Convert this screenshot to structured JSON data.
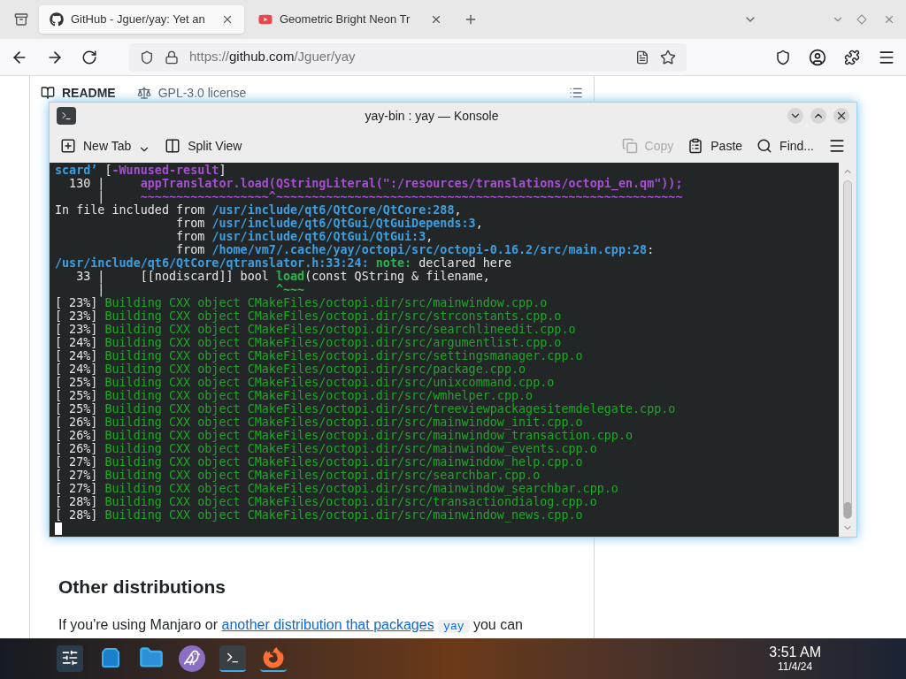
{
  "browser": {
    "tabs": [
      {
        "title": "GitHub - Jguer/yay: Yet an",
        "selected": true,
        "kind": "github"
      },
      {
        "title": "Geometric Bright Neon Tr",
        "selected": false,
        "kind": "youtube"
      }
    ],
    "url": {
      "scheme": "https://",
      "host": "github.com",
      "path": "/Jguer/yay"
    }
  },
  "page": {
    "readme_tabs": [
      {
        "label": "README",
        "selected": true,
        "kind": "book"
      },
      {
        "label": "GPL-3.0 license",
        "selected": false,
        "kind": "scale"
      }
    ],
    "heading": "Other distributions",
    "paragraph": {
      "before": "If you're using Manjaro or ",
      "link": "another distribution that packages",
      "code": "yay",
      "after": " you can"
    }
  },
  "konsole": {
    "title": "yay-bin : yay — Konsole",
    "toolbar_left": [
      {
        "label": "New Tab",
        "kind": "newtab",
        "dropdown": true,
        "disabled": false
      },
      {
        "label": "Split View",
        "kind": "split",
        "dropdown": false,
        "disabled": false
      }
    ],
    "toolbar_right": [
      {
        "label": "Copy",
        "kind": "copy",
        "disabled": true
      },
      {
        "label": "Paste",
        "kind": "paste",
        "disabled": false
      },
      {
        "label": "Find...",
        "kind": "find",
        "disabled": false
      }
    ],
    "lines": [
      [
        {
          "text": "scard’",
          "kind": "path"
        },
        {
          "text": " [",
          "kind": "plain"
        },
        {
          "text": "-Wunused-result",
          "kind": "warn"
        },
        {
          "text": "]",
          "kind": "plain"
        }
      ],
      [
        {
          "text": "  130 |     ",
          "kind": "plain"
        },
        {
          "text": "appTranslator.load(QStringLiteral(\":/resources/translations/octopi_en.qm\"));",
          "kind": "warn"
        }
      ],
      [
        {
          "text": "      |     ",
          "kind": "plain"
        },
        {
          "text": "~~~~~~~~~~~~~~~~~~^~~~~~~~~~~~~~~~~~~~~~~~~~~~~~~~~~~~~~~~~~~~~~~~~~~~~~~~~~",
          "kind": "warn"
        }
      ],
      [
        {
          "text": "In file included from ",
          "kind": "plain"
        },
        {
          "text": "/usr/include/qt6/QtCore/QtCore:288",
          "kind": "path"
        },
        {
          "text": ",",
          "kind": "plain"
        }
      ],
      [
        {
          "text": "                 from ",
          "kind": "plain"
        },
        {
          "text": "/usr/include/qt6/QtGui/QtGuiDepends:3",
          "kind": "path"
        },
        {
          "text": ",",
          "kind": "plain"
        }
      ],
      [
        {
          "text": "                 from ",
          "kind": "plain"
        },
        {
          "text": "/usr/include/qt6/QtGui/QtGui:3",
          "kind": "path"
        },
        {
          "text": ",",
          "kind": "plain"
        }
      ],
      [
        {
          "text": "                 from ",
          "kind": "plain"
        },
        {
          "text": "/home/vm7/.cache/yay/octopi/src/octopi-0.16.2/src/main.cpp:28",
          "kind": "path"
        },
        {
          "text": ":",
          "kind": "plain"
        }
      ],
      [
        {
          "text": "/usr/include/qt6/QtCore/qtranslator.h:33:24:",
          "kind": "path"
        },
        {
          "text": " note:",
          "kind": "note"
        },
        {
          "text": " declared here",
          "kind": "plain"
        }
      ],
      [
        {
          "text": "   33 |     [[nodiscard]] bool ",
          "kind": "plain"
        },
        {
          "text": "load",
          "kind": "note"
        },
        {
          "text": "(const QString & filename,",
          "kind": "plain"
        }
      ],
      [
        {
          "text": "      |                        ",
          "kind": "plain"
        },
        {
          "text": "^~~~",
          "kind": "note"
        }
      ],
      [
        {
          "text": "[ 23%] ",
          "kind": "plain"
        },
        {
          "text": "Building CXX object CMakeFiles/octopi.dir/src/mainwindow.cpp.o",
          "kind": "build"
        }
      ],
      [
        {
          "text": "[ 23%] ",
          "kind": "plain"
        },
        {
          "text": "Building CXX object CMakeFiles/octopi.dir/src/strconstants.cpp.o",
          "kind": "build"
        }
      ],
      [
        {
          "text": "[ 23%] ",
          "kind": "plain"
        },
        {
          "text": "Building CXX object CMakeFiles/octopi.dir/src/searchlineedit.cpp.o",
          "kind": "build"
        }
      ],
      [
        {
          "text": "[ 24%] ",
          "kind": "plain"
        },
        {
          "text": "Building CXX object CMakeFiles/octopi.dir/src/argumentlist.cpp.o",
          "kind": "build"
        }
      ],
      [
        {
          "text": "[ 24%] ",
          "kind": "plain"
        },
        {
          "text": "Building CXX object CMakeFiles/octopi.dir/src/settingsmanager.cpp.o",
          "kind": "build"
        }
      ],
      [
        {
          "text": "[ 24%] ",
          "kind": "plain"
        },
        {
          "text": "Building CXX object CMakeFiles/octopi.dir/src/package.cpp.o",
          "kind": "build"
        }
      ],
      [
        {
          "text": "[ 25%] ",
          "kind": "plain"
        },
        {
          "text": "Building CXX object CMakeFiles/octopi.dir/src/unixcommand.cpp.o",
          "kind": "build"
        }
      ],
      [
        {
          "text": "[ 25%] ",
          "kind": "plain"
        },
        {
          "text": "Building CXX object CMakeFiles/octopi.dir/src/wmhelper.cpp.o",
          "kind": "build"
        }
      ],
      [
        {
          "text": "[ 25%] ",
          "kind": "plain"
        },
        {
          "text": "Building CXX object CMakeFiles/octopi.dir/src/treeviewpackagesitemdelegate.cpp.o",
          "kind": "build"
        }
      ],
      [
        {
          "text": "[ 26%] ",
          "kind": "plain"
        },
        {
          "text": "Building CXX object CMakeFiles/octopi.dir/src/mainwindow_init.cpp.o",
          "kind": "build"
        }
      ],
      [
        {
          "text": "[ 26%] ",
          "kind": "plain"
        },
        {
          "text": "Building CXX object CMakeFiles/octopi.dir/src/mainwindow_transaction.cpp.o",
          "kind": "build"
        }
      ],
      [
        {
          "text": "[ 26%] ",
          "kind": "plain"
        },
        {
          "text": "Building CXX object CMakeFiles/octopi.dir/src/mainwindow_events.cpp.o",
          "kind": "build"
        }
      ],
      [
        {
          "text": "[ 27%] ",
          "kind": "plain"
        },
        {
          "text": "Building CXX object CMakeFiles/octopi.dir/src/mainwindow_help.cpp.o",
          "kind": "build"
        }
      ],
      [
        {
          "text": "[ 27%] ",
          "kind": "plain"
        },
        {
          "text": "Building CXX object CMakeFiles/octopi.dir/src/searchbar.cpp.o",
          "kind": "build"
        }
      ],
      [
        {
          "text": "[ 27%] ",
          "kind": "plain"
        },
        {
          "text": "Building CXX object CMakeFiles/octopi.dir/src/mainwindow_searchbar.cpp.o",
          "kind": "build"
        }
      ],
      [
        {
          "text": "[ 28%] ",
          "kind": "plain"
        },
        {
          "text": "Building CXX object CMakeFiles/octopi.dir/src/transactiondialog.cpp.o",
          "kind": "build"
        }
      ],
      [
        {
          "text": "[ 28%] ",
          "kind": "plain"
        },
        {
          "text": "Building CXX object CMakeFiles/octopi.dir/src/mainwindow_news.cpp.o",
          "kind": "build"
        }
      ]
    ]
  },
  "taskbar": {
    "apps": [
      {
        "kind": "settings",
        "active": false
      },
      {
        "kind": "store",
        "active": false
      },
      {
        "kind": "files",
        "active": false
      },
      {
        "kind": "bird",
        "active": false
      },
      {
        "kind": "terminal",
        "active": true
      },
      {
        "kind": "firefox",
        "active": true
      }
    ],
    "time": "3:51 AM",
    "date": "11/4/24"
  }
}
